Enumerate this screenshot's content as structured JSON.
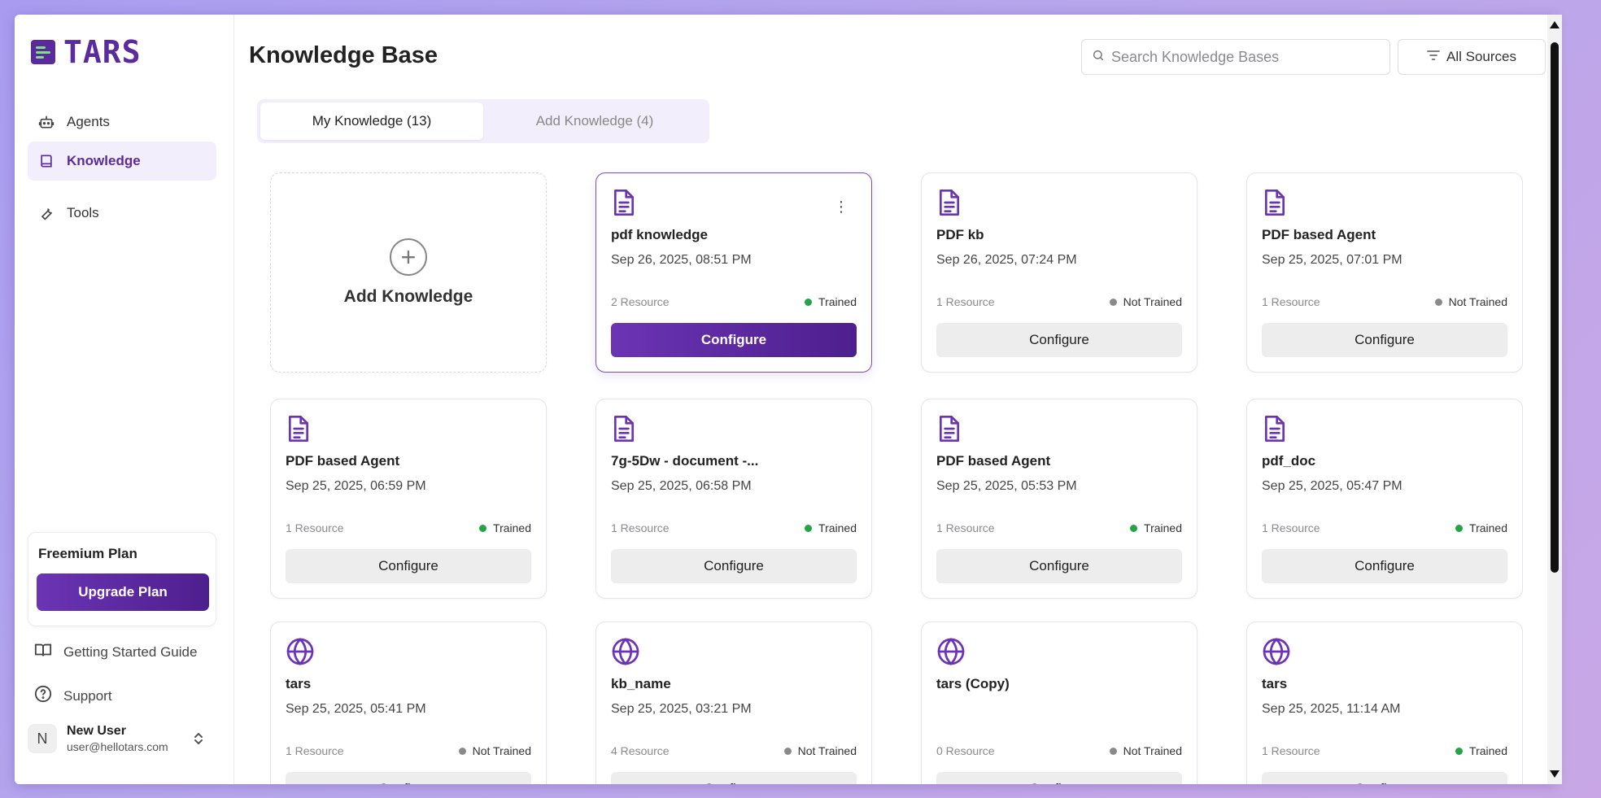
{
  "app": {
    "name": "TARS"
  },
  "sidebar": {
    "items": [
      {
        "label": "Agents",
        "icon": "robot-icon",
        "active": false
      },
      {
        "label": "Knowledge",
        "icon": "book-icon",
        "active": true
      },
      {
        "label": "Tools",
        "icon": "wrench-icon",
        "active": false
      }
    ],
    "plan": {
      "title": "Freemium Plan",
      "upgrade_label": "Upgrade Plan"
    },
    "links": [
      {
        "label": "Getting Started Guide",
        "icon": "open-book-icon"
      },
      {
        "label": "Support",
        "icon": "help-circle-icon"
      }
    ],
    "user": {
      "initial": "N",
      "name": "New User",
      "email": "user@hellotars.com"
    }
  },
  "header": {
    "title": "Knowledge Base",
    "search_placeholder": "Search Knowledge Bases",
    "filter_label": "All Sources"
  },
  "tabs": [
    {
      "label": "My Knowledge (13)",
      "active": true
    },
    {
      "label": "Add Knowledge (4)",
      "active": false
    }
  ],
  "add_card": {
    "label": "Add Knowledge"
  },
  "cards": [
    {
      "type": "document",
      "title": "pdf knowledge",
      "date": "Sep 26, 2025, 08:51 PM",
      "resources": "2 Resource",
      "status": "Trained",
      "configure": "Configure",
      "selected": true
    },
    {
      "type": "document",
      "title": "PDF kb",
      "date": "Sep 26, 2025, 07:24 PM",
      "resources": "1 Resource",
      "status": "Not Trained",
      "configure": "Configure",
      "selected": false
    },
    {
      "type": "document",
      "title": "PDF based Agent",
      "date": "Sep 25, 2025, 07:01 PM",
      "resources": "1 Resource",
      "status": "Not Trained",
      "configure": "Configure",
      "selected": false
    },
    {
      "type": "document",
      "title": "PDF based Agent",
      "date": "Sep 25, 2025, 06:59 PM",
      "resources": "1 Resource",
      "status": "Trained",
      "configure": "Configure",
      "selected": false
    },
    {
      "type": "document",
      "title": "7g-5Dw - document -...",
      "date": "Sep 25, 2025, 06:58 PM",
      "resources": "1 Resource",
      "status": "Trained",
      "configure": "Configure",
      "selected": false
    },
    {
      "type": "document",
      "title": "PDF based Agent",
      "date": "Sep 25, 2025, 05:53 PM",
      "resources": "1 Resource",
      "status": "Trained",
      "configure": "Configure",
      "selected": false
    },
    {
      "type": "document",
      "title": "pdf_doc",
      "date": "Sep 25, 2025, 05:47 PM",
      "resources": "1 Resource",
      "status": "Trained",
      "configure": "Configure",
      "selected": false
    },
    {
      "type": "website",
      "title": "tars",
      "date": "Sep 25, 2025, 05:41 PM",
      "resources": "1 Resource",
      "status": "Not Trained",
      "configure": "Configure",
      "selected": false
    },
    {
      "type": "website",
      "title": "kb_name",
      "date": "Sep 25, 2025, 03:21 PM",
      "resources": "4 Resource",
      "status": "Not Trained",
      "configure": "Configure",
      "selected": false
    },
    {
      "type": "website",
      "title": "tars (Copy)",
      "date": "",
      "resources": "0 Resource",
      "status": "Not Trained",
      "configure": "Configure",
      "selected": false
    },
    {
      "type": "website",
      "title": "tars",
      "date": "Sep 25, 2025, 11:14 AM",
      "resources": "1 Resource",
      "status": "Trained",
      "configure": "Configure",
      "selected": false
    }
  ],
  "colors": {
    "brand": "#5b2a9c",
    "brand_light": "#f3eefc",
    "trained": "#22a447",
    "not_trained": "#8a8a8a"
  }
}
